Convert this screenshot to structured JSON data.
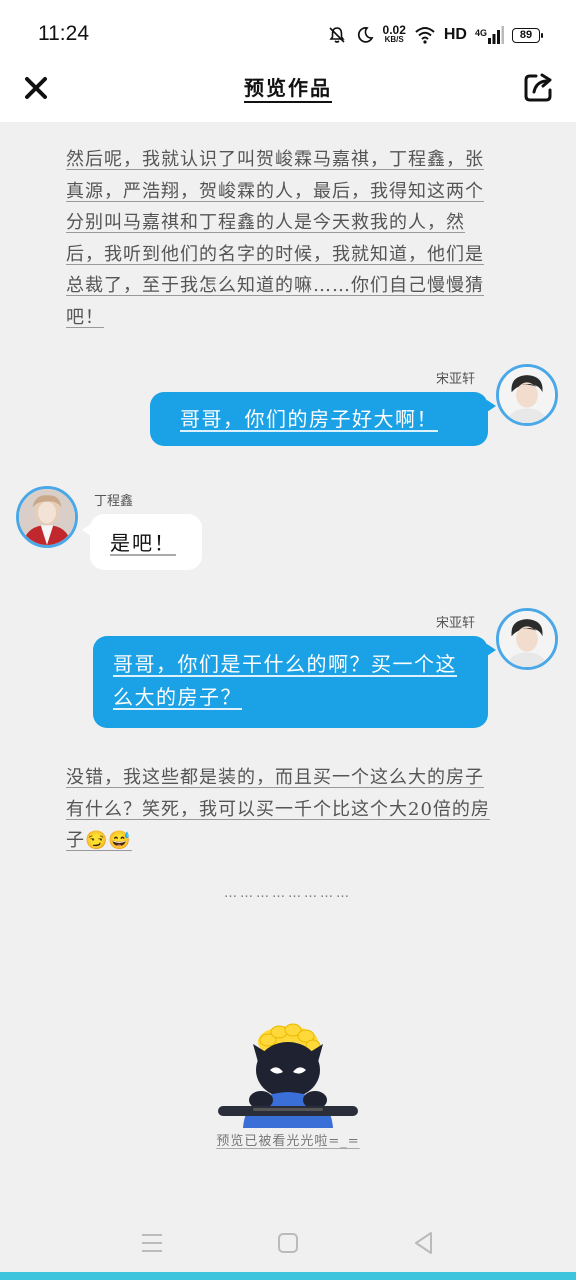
{
  "status_bar": {
    "time": "11:24",
    "net_speed_value": "0.02",
    "net_speed_unit": "KB/S",
    "hd_label": "HD",
    "signal_label": "4G",
    "battery": "89",
    "icons": [
      "mute-bell-icon",
      "moon-icon",
      "wifi-icon",
      "signal-icon",
      "battery-icon"
    ]
  },
  "header": {
    "title": "预览作品",
    "close_icon": "close-icon",
    "share_icon": "share-icon"
  },
  "messages": {
    "narration_1": "然后呢，我就认识了叫贺峻霖马嘉祺，丁程鑫，张真源，严浩翔，贺峻霖的人，最后，我得知这两个分别叫马嘉祺和丁程鑫的人是今天救我的人，然后，我听到他们的名字的时候，我就知道，他们是总裁了，至于我怎么知道的嘛……你们自己慢慢猜吧！",
    "msg_1_speaker": "宋亚轩",
    "msg_1_text": "哥哥，你们的房子好大啊！",
    "msg_2_speaker": "丁程鑫",
    "msg_2_text": "是吧！",
    "msg_3_speaker": "宋亚轩",
    "msg_3_text": "哥哥，你们是干什么的啊？买一个这么大的房子？",
    "narration_2": "没错，我这些都是装的，而且买一个这么大的房子有什么？笑死，我可以买一千个比这个大20倍的房子😏😅",
    "ellipsis": "……………………"
  },
  "footer": {
    "preview_note": "预览已被看光光啦=_=",
    "nav_icons": [
      "menu-icon",
      "home-icon",
      "back-icon"
    ]
  },
  "colors": {
    "accent": "#1ba2e6",
    "avatar_border": "#4aa8e8",
    "background": "#f0f0f0",
    "bottom_strip": "#3ec5dd"
  }
}
